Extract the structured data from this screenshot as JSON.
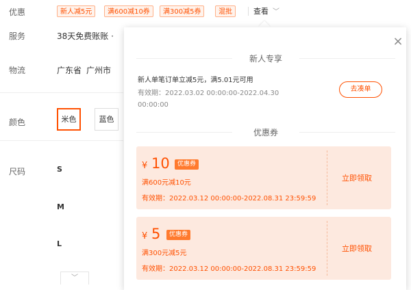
{
  "offers": {
    "label": "优惠",
    "tags": [
      "新人减5元",
      "满600减10券",
      "满300减5券",
      "混批"
    ],
    "view_label": "查看",
    "view_chevron": "﹀"
  },
  "service": {
    "label": "服务",
    "text": "38天免费账账 ·"
  },
  "logistics": {
    "label": "物流",
    "province": "广东省",
    "city": "广州市"
  },
  "color": {
    "label": "颜色",
    "options": [
      "米色",
      "蓝色"
    ]
  },
  "size": {
    "label": "尺码",
    "options": [
      "S",
      "M",
      "L"
    ]
  },
  "popup": {
    "close_glyph": "×",
    "newuser": {
      "title": "新人专享",
      "desc": "新人单笔订单立减5元，满5.01元可用",
      "validity": "有效期：2022.03.02 00:00:00-2022.04.30 00:00:00",
      "button": "去凑单"
    },
    "coupons_title": "优惠券",
    "coupons": [
      {
        "currency": "¥",
        "amount": "10",
        "badge": "优惠券",
        "condition": "满600元减10元",
        "validity": "有效期：2022.03.12 00:00:00-2022.08.31 23:59:59",
        "action": "立即领取"
      },
      {
        "currency": "¥",
        "amount": "5",
        "badge": "优惠券",
        "condition": "满300元减5元",
        "validity": "有效期：2022.03.12 00:00:00-2022.08.31 23:59:59",
        "action": "立即领取"
      }
    ]
  },
  "expand_chevron": "﹀",
  "colors": {
    "accent": "#ff5000",
    "coupon_bg": "#fde9df"
  }
}
